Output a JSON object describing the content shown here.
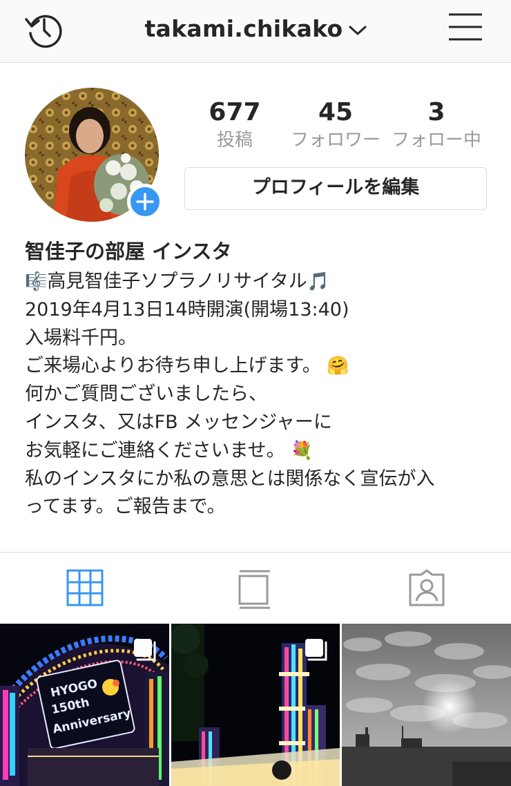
{
  "header": {
    "username": "takami.chikako"
  },
  "profile": {
    "stats": [
      {
        "value": "677",
        "label": "投稿"
      },
      {
        "value": "45",
        "label": "フォロワー"
      },
      {
        "value": "3",
        "label": "フォロー中"
      }
    ],
    "edit_button": "プロフィールを編集"
  },
  "bio": {
    "name": "智佳子の部屋 インスタ",
    "lines": [
      "高見智佳子ソプラノリサイタル",
      "2019年4月13日14時開演(開場13:40)",
      "入場料千円。",
      "ご来場心よりお待ち申し上げます。",
      "何かご質問ございましたら、",
      "インスタ、又はFB メッセンジャーに",
      "お気軽にご連絡くださいませ。",
      "私のインスタにか私の意思とは関係なく宣伝が入",
      "ってます。ご報告まで。"
    ],
    "emojis": {
      "clef": "🎼",
      "notes": "🎵",
      "hug": "🤗",
      "bouquet": "💐"
    }
  },
  "tabs": [
    {
      "icon": "grid-icon",
      "active": true,
      "color": "#3897f0"
    },
    {
      "icon": "feed-icon",
      "active": false,
      "color": "#999999"
    },
    {
      "icon": "tagged-icon",
      "active": false,
      "color": "#999999"
    }
  ],
  "posts": [
    {
      "overlay_text": [
        "HYOGO",
        "150th",
        "Anniversary"
      ],
      "multiple": true
    },
    {
      "multiple": true
    },
    {
      "multiple": false
    }
  ]
}
